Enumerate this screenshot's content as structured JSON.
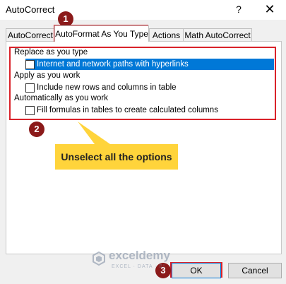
{
  "window": {
    "title": "AutoCorrect",
    "help_glyph": "?",
    "close_glyph": "✕"
  },
  "tabs": [
    {
      "label": "AutoCorrect",
      "active": false
    },
    {
      "label": "AutoFormat As You Type",
      "active": true
    },
    {
      "label": "Actions",
      "active": false
    },
    {
      "label": "Math AutoCorrect",
      "active": false
    }
  ],
  "sections": [
    {
      "heading": "Replace as you type",
      "options": [
        {
          "label": "Internet and network paths with hyperlinks",
          "checked": false,
          "highlighted": true
        }
      ]
    },
    {
      "heading": "Apply as you work",
      "options": [
        {
          "label": "Include new rows and columns in table",
          "checked": false,
          "highlighted": false
        }
      ]
    },
    {
      "heading": "Automatically as you work",
      "options": [
        {
          "label": "Fill formulas in tables to create calculated columns",
          "checked": false,
          "highlighted": false
        }
      ]
    }
  ],
  "annotations": {
    "badge_1": "1",
    "badge_2": "2",
    "badge_3": "3",
    "callout": "Unselect all the options",
    "annotation_color": "#d9222a",
    "badge_color": "#8b1a1a",
    "callout_color": "#ffd43b"
  },
  "buttons": {
    "ok": "OK",
    "cancel": "Cancel"
  },
  "watermark": {
    "name": "exceldemy",
    "tagline": "EXCEL · DATA · BI"
  },
  "colors": {
    "selection": "#0078d7",
    "dialog_bg": "#f0f0f0"
  }
}
